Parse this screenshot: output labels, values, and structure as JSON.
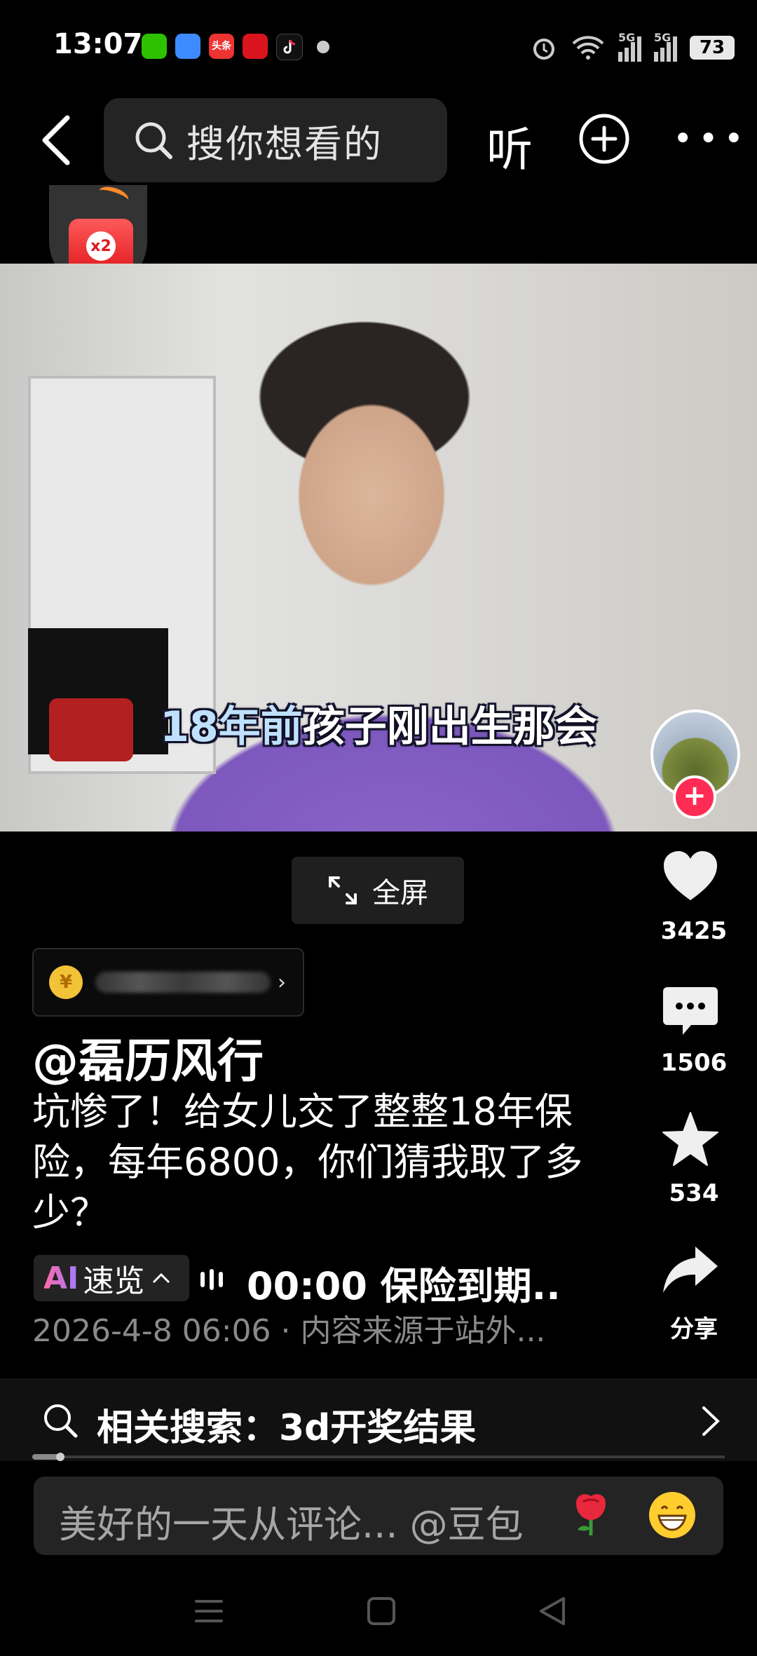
{
  "status_bar": {
    "time": "13:07",
    "apps": [
      "wechat-icon",
      "blue-app-icon",
      "toutiao-icon",
      "red-app-icon",
      "douyin-icon"
    ],
    "toutiao_label": "头条",
    "network_1": "5G",
    "network_2": "5G",
    "battery": "73"
  },
  "top_nav": {
    "search_placeholder": "搜你想看的",
    "listen_label": "听"
  },
  "video": {
    "caption_highlight": "18年前",
    "caption_rest": "孩子刚出生那会"
  },
  "fullscreen": {
    "label": "全屏"
  },
  "actions": {
    "likes": "3425",
    "comments": "1506",
    "favorites": "534",
    "share_label": "分享"
  },
  "post": {
    "author": "@磊历风行",
    "title": "坑惨了！给女儿交了整整18年保险，每年6800，你们猜我取了多少？",
    "ai_mark": "AI",
    "ai_label": "速览",
    "chapter": "00:00 保险到期..",
    "meta": "2026-4-8 06:06 · 内容来源于站外..."
  },
  "related_search": {
    "text": "相关搜索：3d开奖结果"
  },
  "comment_bar": {
    "placeholder": "美好的一天从评论... @豆包"
  },
  "colors": {
    "accent": "#fe2c55",
    "background": "#000000"
  }
}
